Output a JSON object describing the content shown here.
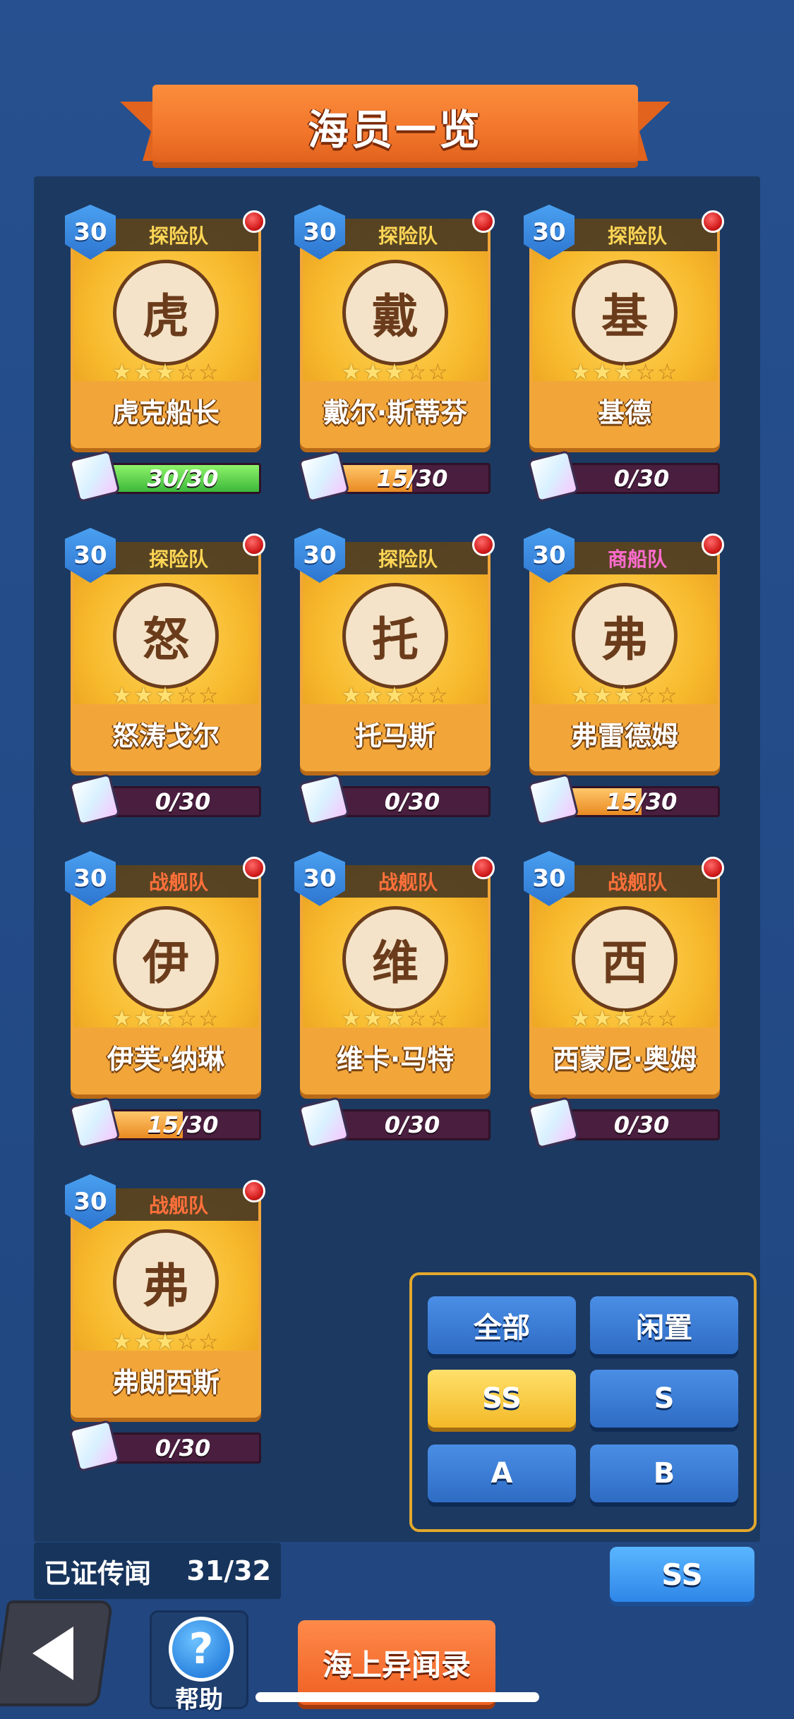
{
  "title": "海员一览",
  "crew": [
    {
      "level": "30",
      "team": "探险队",
      "team_kind": "explore",
      "name": "虎克船长",
      "initial": "虎",
      "stars": 3,
      "progress_text": "30/30",
      "progress": 1.0,
      "fill": "green"
    },
    {
      "level": "30",
      "team": "探险队",
      "team_kind": "explore",
      "name": "戴尔·斯蒂芬",
      "initial": "戴",
      "stars": 3,
      "progress_text": "15/30",
      "progress": 0.5,
      "fill": "orange"
    },
    {
      "level": "30",
      "team": "探险队",
      "team_kind": "explore",
      "name": "基德",
      "initial": "基",
      "stars": 3,
      "progress_text": "0/30",
      "progress": 0.0,
      "fill": "orange"
    },
    {
      "level": "30",
      "team": "探险队",
      "team_kind": "explore",
      "name": "怒涛戈尔",
      "initial": "怒",
      "stars": 3,
      "progress_text": "0/30",
      "progress": 0.0,
      "fill": "orange"
    },
    {
      "level": "30",
      "team": "探险队",
      "team_kind": "explore",
      "name": "托马斯",
      "initial": "托",
      "stars": 3,
      "progress_text": "0/30",
      "progress": 0.0,
      "fill": "orange"
    },
    {
      "level": "30",
      "team": "商船队",
      "team_kind": "merchant",
      "name": "弗雷德姆",
      "initial": "弗",
      "stars": 3,
      "progress_text": "15/30",
      "progress": 0.5,
      "fill": "orange"
    },
    {
      "level": "30",
      "team": "战舰队",
      "team_kind": "warship",
      "name": "伊芙·纳琳",
      "initial": "伊",
      "stars": 3,
      "progress_text": "15/30",
      "progress": 0.5,
      "fill": "orange"
    },
    {
      "level": "30",
      "team": "战舰队",
      "team_kind": "warship",
      "name": "维卡·马特",
      "initial": "维",
      "stars": 3,
      "progress_text": "0/30",
      "progress": 0.0,
      "fill": "orange"
    },
    {
      "level": "30",
      "team": "战舰队",
      "team_kind": "warship",
      "name": "西蒙尼·奥姆",
      "initial": "西",
      "stars": 3,
      "progress_text": "0/30",
      "progress": 0.0,
      "fill": "orange"
    },
    {
      "level": "30",
      "team": "战舰队",
      "team_kind": "warship",
      "name": "弗朗西斯",
      "initial": "弗",
      "stars": 3,
      "progress_text": "0/30",
      "progress": 0.0,
      "fill": "orange"
    }
  ],
  "max_stars": 5,
  "filters": {
    "all": "全部",
    "idle": "闲置",
    "ss": "SS",
    "s": "S",
    "a": "A",
    "b": "B",
    "selected": "ss"
  },
  "footer": {
    "proof_label": "已证传闻",
    "proof_count": "31/32",
    "rank_button": "SS",
    "help_label": "帮助",
    "help_glyph": "?",
    "journal_label": "海上异闻录"
  },
  "colors": {
    "team_explore": "#ffd95a",
    "team_merchant": "#ff66dd",
    "team_warship": "#ff6a3d",
    "level_badge": "#2d75d0",
    "selected_filter": "#f3b928"
  }
}
